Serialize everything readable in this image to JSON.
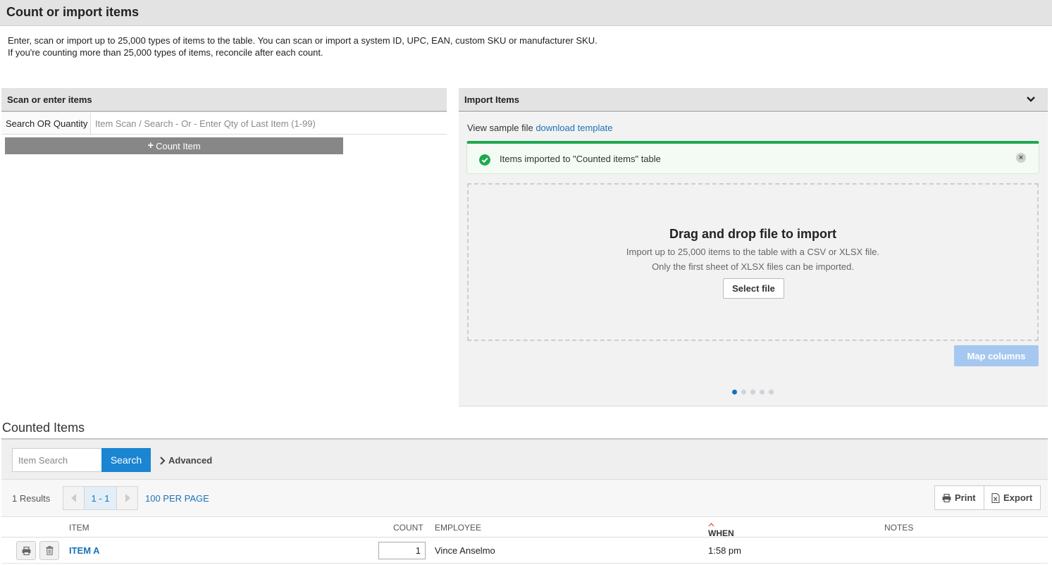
{
  "page": {
    "title": "Count or import items",
    "intro_line1": "Enter, scan or import up to 25,000 types of items to the table. You can scan or import a system ID, UPC, EAN, custom SKU or manufacturer SKU.",
    "intro_line2": "If you're counting more than 25,000 types of items, reconcile after each count."
  },
  "scan_panel": {
    "title": "Scan or enter items",
    "field_label": "Search OR Quantity",
    "input_value": "",
    "input_placeholder": "Item Scan / Search - Or - Enter Qty of Last Item (1-99)",
    "count_button": "Count Item"
  },
  "import_panel": {
    "title": "Import Items",
    "sample_text": "View sample file",
    "template_link": "download template",
    "alert_message": "Items imported to \"Counted items\" table",
    "dropzone_title": "Drag and drop file to import",
    "dropzone_line1": "Import up to 25,000 items to the table with a CSV or XLSX file.",
    "dropzone_line2": "Only the first sheet of XLSX files can be imported.",
    "select_file_button": "Select file",
    "map_columns_button": "Map columns",
    "step_dots": 5,
    "active_step": 1,
    "colors": {
      "success": "#1fa84f",
      "accent": "#1a73b8",
      "map_disabled": "#a6c8f0"
    }
  },
  "counted": {
    "title": "Counted Items",
    "search_value": "",
    "search_placeholder": "Item Search",
    "search_button": "Search",
    "advanced_label": "Advanced",
    "results_text": "1 Results",
    "page_range": "1 - 1",
    "per_page": "100 PER PAGE",
    "print_button": "Print",
    "export_button": "Export",
    "columns": {
      "item": "ITEM",
      "count": "COUNT",
      "employee": "EMPLOYEE",
      "when": "WHEN",
      "notes": "NOTES"
    },
    "sort_column": "WHEN",
    "rows": [
      {
        "item": "ITEM A",
        "count": "1",
        "employee": "Vince Anselmo",
        "when": "1:58 pm",
        "notes": ""
      }
    ]
  }
}
